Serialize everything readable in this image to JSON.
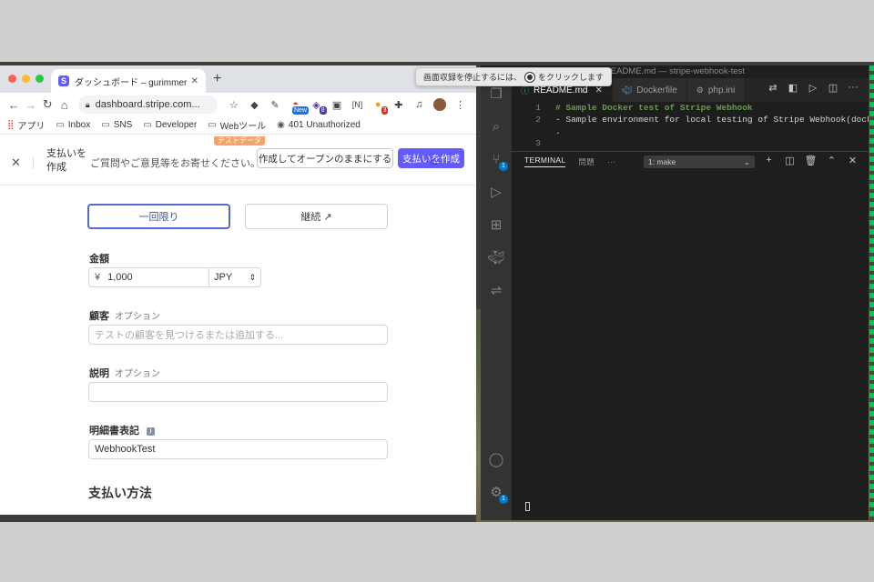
{
  "recording_tip": {
    "text_before": "画面収録を停止するには、",
    "text_after": "をクリックします"
  },
  "chrome": {
    "tab_title": "ダッシュボード – gurimmer – Stripe",
    "url": "dashboard.stripe.com...",
    "bookmarks": [
      "アプリ",
      "Inbox",
      "SNS",
      "Developer",
      "Webツール",
      "401 Unauthorized"
    ],
    "ext_badges": {
      "new": "New",
      "eight": "8",
      "three": "3"
    }
  },
  "stripe": {
    "test_badge": "テストデータ",
    "header_title": "支払いを作成",
    "feedback": "ご質問やご意見等をお寄せください。",
    "btn_open": "作成してオープンのままにする",
    "btn_create": "支払いを作成",
    "seg_once": "一回限り",
    "seg_recurring": "継続 ↗",
    "amount_label": "金額",
    "amount_symbol": "¥",
    "amount_value": "1,000",
    "currency": "JPY",
    "customer_label": "顧客",
    "optional": "オプション",
    "customer_placeholder": "テストの顧客を見つけるまたは追加する...",
    "description_label": "説明",
    "statement_label": "明細書表記",
    "statement_value": "WebhookTest",
    "payment_method": "支払い方法"
  },
  "vscode": {
    "title": "README.md — stripe-webhook-test",
    "tabs": [
      "README.md",
      "Dockerfile",
      "php.ini"
    ],
    "code": [
      {
        "n": "1",
        "text": "# Sample Docker test of Stripe Webhook"
      },
      {
        "n": "2",
        "text": "- Sample environment for local testing of Stripe Webhook(docker)"
      },
      {
        "n": "",
        "text": "."
      },
      {
        "n": "3",
        "text": ""
      }
    ],
    "panel_tabs": [
      "TERMINAL",
      "問題",
      "···"
    ],
    "terminal_select": "1: make",
    "badge_count": "1"
  }
}
